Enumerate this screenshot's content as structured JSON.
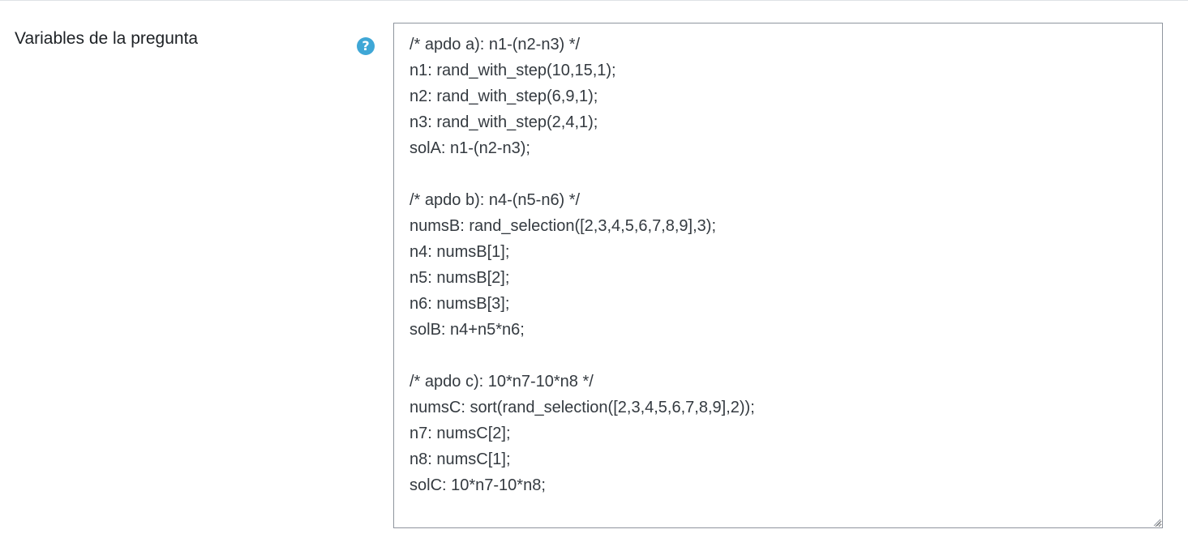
{
  "form": {
    "field": {
      "label": "Variables de la pregunta",
      "help_icon": "question-circle-icon",
      "help_icon_glyph": "?",
      "value": "/* apdo a): n1-(n2-n3) */\nn1: rand_with_step(10,15,1);\nn2: rand_with_step(6,9,1);\nn3: rand_with_step(2,4,1);\nsolA: n1-(n2-n3);\n\n/* apdo b): n4-(n5-n6) */\nnumsB: rand_selection([2,3,4,5,6,7,8,9],3);\nn4: numsB[1];\nn5: numsB[2];\nn6: numsB[3];\nsolB: n4+n5*n6;\n\n/* apdo c): 10*n7-10*n8 */\nnumsC: sort(rand_selection([2,3,4,5,6,7,8,9],2));\nn7: numsC[2];\nn8: numsC[1];\nsolC: 10*n7-10*n8;"
    }
  },
  "colors": {
    "help_icon": "#3fa7d6",
    "textarea_border": "#8f959e",
    "text": "#343a40",
    "divider": "#dee2e6"
  }
}
